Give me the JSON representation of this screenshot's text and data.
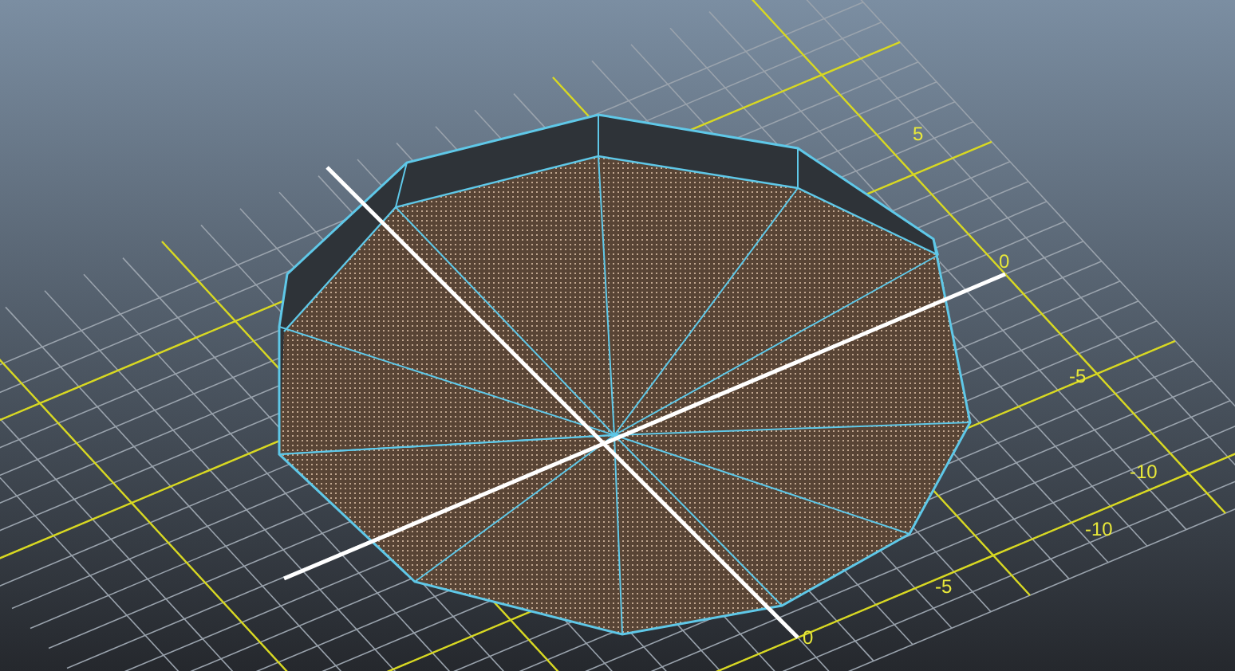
{
  "viewport": {
    "grid_labels": [
      "5",
      "0",
      "-5",
      "-10",
      "-10",
      "-5",
      "0"
    ]
  }
}
